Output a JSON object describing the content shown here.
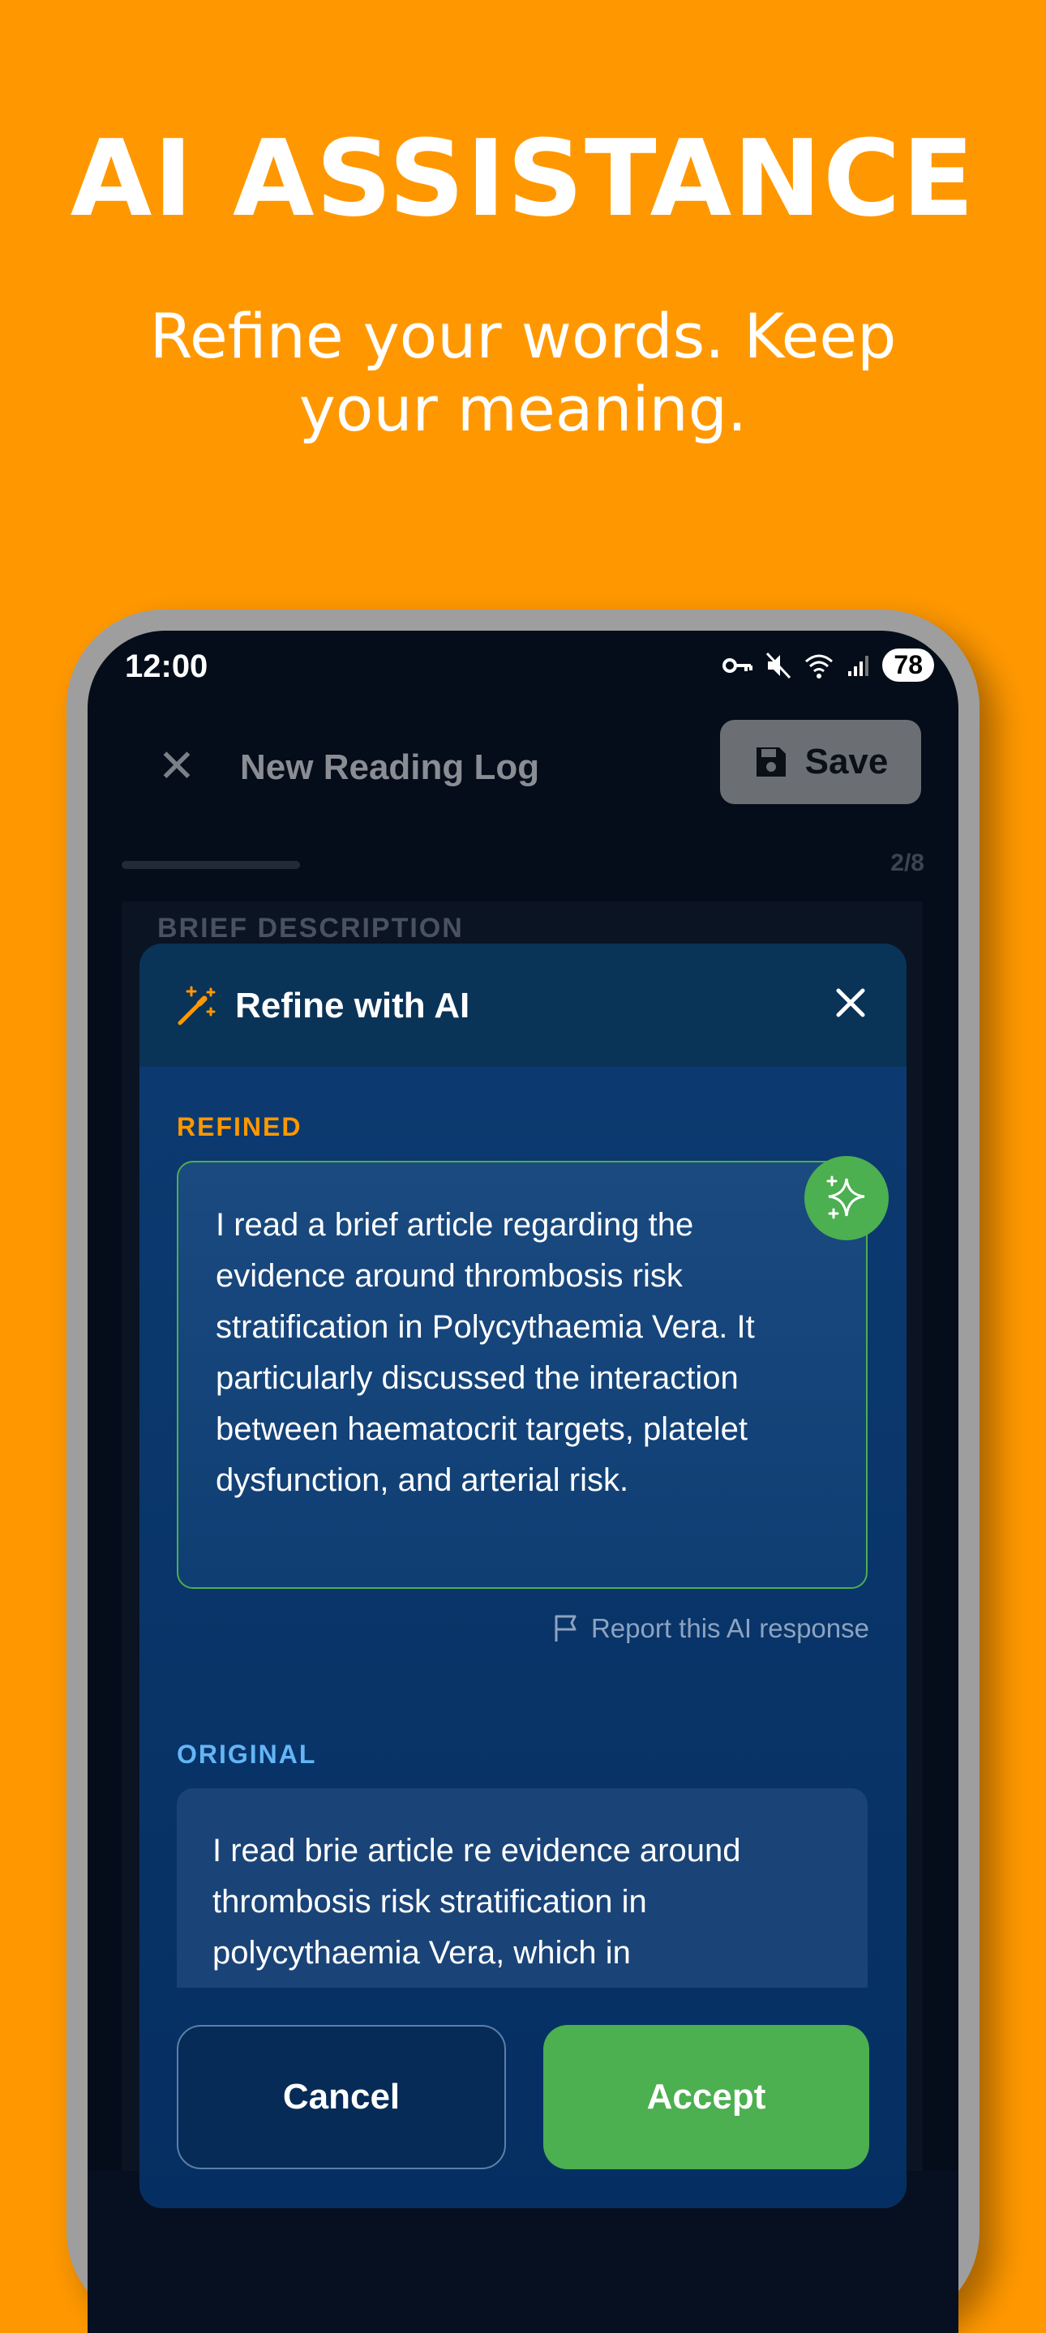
{
  "hero": {
    "title": "AI ASSISTANCE",
    "subtitle": "Refine your words. Keep your meaning."
  },
  "status_bar": {
    "time": "12:00",
    "battery": "78",
    "icons": [
      "key-icon",
      "mute-icon",
      "wifi-icon",
      "signal-icon"
    ]
  },
  "app_bar": {
    "title": "New Reading Log",
    "save_label": "Save"
  },
  "progress": {
    "text": "2/8"
  },
  "section": {
    "label": "BRIEF DESCRIPTION"
  },
  "sheet": {
    "title": "Refine with AI",
    "refined_label": "REFINED",
    "refined_text": "I read a brief article regarding the evidence around thrombosis risk stratification in Polycythaemia Vera. It particularly discussed the interaction between haematocrit targets, platelet dysfunction, and arterial risk.",
    "report_label": "Report this AI response",
    "original_label": "ORIGINAL",
    "original_text": "I read brie article re evidence around thrombosis risk stratification in polycythaemia Vera, which in",
    "cancel_label": "Cancel",
    "accept_label": "Accept"
  },
  "colors": {
    "background": "#FF9800",
    "accent_green": "#4CAF50",
    "label_orange": "#FF9800",
    "label_blue": "#64B5F6",
    "sheet_bg": "#0b3566"
  }
}
